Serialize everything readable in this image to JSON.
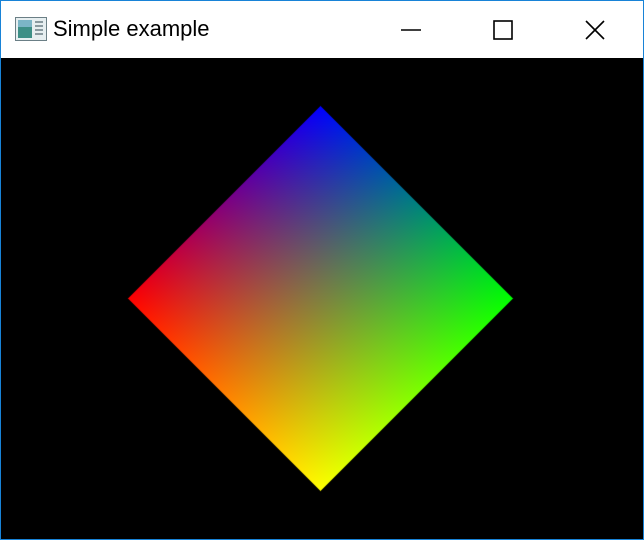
{
  "window": {
    "title": "Simple example",
    "app_icon": "window-app-icon",
    "border_color": "#1883d7",
    "titlebar_color": "#ffffff",
    "client_background": "#000000"
  },
  "caption_buttons": {
    "minimize_icon": "minimize-icon",
    "maximize_icon": "maximize-icon",
    "close_icon": "close-icon"
  },
  "scene": {
    "shape": "diamond",
    "vertex_colors": {
      "top": "#0000ff",
      "right": "#00ff00",
      "bottom": "#ffff00",
      "left": "#ff0000"
    }
  }
}
